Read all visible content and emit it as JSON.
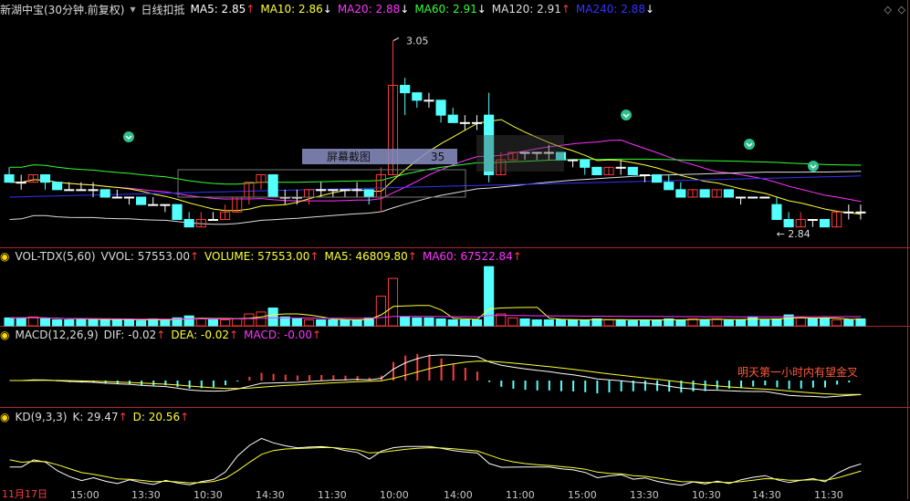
{
  "header": {
    "title": "新湖中宝(30分钟.前复权)",
    "indicator": "日线扣抵",
    "ma": [
      {
        "label": "MA5: 2.85",
        "arrow": "↑",
        "color": "#ffffff"
      },
      {
        "label": "MA10: 2.86",
        "arrow": "↓",
        "color": "#ffff33"
      },
      {
        "label": "MA20: 2.88",
        "arrow": "↓",
        "color": "#ff33ff"
      },
      {
        "label": "MA60: 2.91",
        "arrow": "↓",
        "color": "#33ff33"
      },
      {
        "label": "MA120: 2.91",
        "arrow": "↑",
        "color": "#dddddd"
      },
      {
        "label": "MA240: 2.88",
        "arrow": "↓",
        "color": "#3333ff"
      }
    ]
  },
  "volume_header": {
    "name": "VOL-TDX(5,60)",
    "vvol": "VVOL: 57553.00",
    "volume": "VOLUME: 57553.00",
    "ma5": "MA5: 46809.80",
    "ma60": "MA60: 67522.84"
  },
  "macd_header": {
    "name": "MACD(12,26,9)",
    "dif": "DIF: -0.02",
    "dea": "DEA: -0.02",
    "macd": "MACD: -0.00"
  },
  "kd_header": {
    "name": "KD(9,3,3)",
    "k": "K: 29.47",
    "d": "D: 20.56"
  },
  "annotations": {
    "high_label": "3.05",
    "low_label": "2.84",
    "overlay_box": "屏幕截图",
    "overlay_value": "35",
    "macd_note": "明天第一小时内有望金叉"
  },
  "x_axis": [
    "11月17日",
    "15:00",
    "13:30",
    "10:30",
    "14:30",
    "11:30",
    "10:00",
    "14:00",
    "11:00",
    "15:00",
    "13:30",
    "10:30",
    "14:30",
    "11:30"
  ],
  "colors": {
    "up": "#ff3b3b",
    "down": "#54ffff",
    "grid": "#b0272d"
  },
  "chart_data": {
    "type": "candlestick",
    "interval": "30min",
    "ohlc": [
      [
        2.87,
        2.88,
        2.86,
        2.86
      ],
      [
        2.86,
        2.87,
        2.85,
        2.86
      ],
      [
        2.86,
        2.87,
        2.86,
        2.87
      ],
      [
        2.87,
        2.87,
        2.85,
        2.86
      ],
      [
        2.86,
        2.86,
        2.85,
        2.85
      ],
      [
        2.85,
        2.86,
        2.85,
        2.85
      ],
      [
        2.85,
        2.86,
        2.85,
        2.85
      ],
      [
        2.85,
        2.86,
        2.84,
        2.85
      ],
      [
        2.85,
        2.85,
        2.84,
        2.84
      ],
      [
        2.84,
        2.85,
        2.84,
        2.84
      ],
      [
        2.84,
        2.84,
        2.83,
        2.84
      ],
      [
        2.84,
        2.84,
        2.83,
        2.83
      ],
      [
        2.83,
        2.84,
        2.83,
        2.83
      ],
      [
        2.83,
        2.83,
        2.82,
        2.83
      ],
      [
        2.83,
        2.83,
        2.81,
        2.81
      ],
      [
        2.81,
        2.82,
        2.8,
        2.8
      ],
      [
        2.8,
        2.82,
        2.8,
        2.81
      ],
      [
        2.81,
        2.82,
        2.81,
        2.81
      ],
      [
        2.81,
        2.83,
        2.81,
        2.82
      ],
      [
        2.82,
        2.84,
        2.82,
        2.84
      ],
      [
        2.84,
        2.86,
        2.83,
        2.86
      ],
      [
        2.86,
        2.87,
        2.85,
        2.87
      ],
      [
        2.87,
        2.87,
        2.84,
        2.84
      ],
      [
        2.84,
        2.85,
        2.83,
        2.84
      ],
      [
        2.84,
        2.85,
        2.83,
        2.84
      ],
      [
        2.84,
        2.85,
        2.83,
        2.85
      ],
      [
        2.85,
        2.86,
        2.84,
        2.85
      ],
      [
        2.85,
        2.85,
        2.84,
        2.85
      ],
      [
        2.85,
        2.85,
        2.84,
        2.85
      ],
      [
        2.85,
        2.86,
        2.84,
        2.85
      ],
      [
        2.85,
        2.85,
        2.83,
        2.84
      ],
      [
        2.84,
        2.88,
        2.82,
        2.87
      ],
      [
        2.87,
        3.05,
        2.87,
        2.99
      ],
      [
        2.99,
        3.0,
        2.95,
        2.98
      ],
      [
        2.98,
        2.98,
        2.96,
        2.97
      ],
      [
        2.97,
        2.98,
        2.96,
        2.97
      ],
      [
        2.97,
        2.97,
        2.94,
        2.95
      ],
      [
        2.95,
        2.96,
        2.94,
        2.94
      ],
      [
        2.94,
        2.95,
        2.93,
        2.94
      ],
      [
        2.94,
        2.95,
        2.93,
        2.94
      ],
      [
        2.95,
        2.98,
        2.86,
        2.87
      ],
      [
        2.87,
        2.9,
        2.87,
        2.89
      ],
      [
        2.89,
        2.9,
        2.89,
        2.9
      ],
      [
        2.9,
        2.9,
        2.89,
        2.9
      ],
      [
        2.9,
        2.9,
        2.89,
        2.9
      ],
      [
        2.9,
        2.91,
        2.89,
        2.9
      ],
      [
        2.9,
        2.9,
        2.89,
        2.89
      ],
      [
        2.89,
        2.89,
        2.88,
        2.89
      ],
      [
        2.89,
        2.89,
        2.87,
        2.88
      ],
      [
        2.88,
        2.88,
        2.87,
        2.87
      ],
      [
        2.87,
        2.88,
        2.87,
        2.88
      ],
      [
        2.88,
        2.89,
        2.87,
        2.88
      ],
      [
        2.88,
        2.88,
        2.87,
        2.87
      ],
      [
        2.87,
        2.87,
        2.86,
        2.87
      ],
      [
        2.87,
        2.87,
        2.86,
        2.86
      ],
      [
        2.86,
        2.87,
        2.85,
        2.85
      ],
      [
        2.85,
        2.86,
        2.84,
        2.84
      ],
      [
        2.84,
        2.85,
        2.84,
        2.85
      ],
      [
        2.85,
        2.85,
        2.84,
        2.84
      ],
      [
        2.84,
        2.85,
        2.84,
        2.85
      ],
      [
        2.85,
        2.85,
        2.84,
        2.84
      ],
      [
        2.84,
        2.84,
        2.83,
        2.84
      ],
      [
        2.84,
        2.84,
        2.84,
        2.84
      ],
      [
        2.84,
        2.84,
        2.84,
        2.84
      ],
      [
        2.83,
        2.84,
        2.81,
        2.81
      ],
      [
        2.81,
        2.82,
        2.8,
        2.8
      ],
      [
        2.8,
        2.82,
        2.8,
        2.81
      ],
      [
        2.81,
        2.81,
        2.8,
        2.81
      ],
      [
        2.81,
        2.81,
        2.8,
        2.8
      ],
      [
        2.8,
        2.82,
        2.8,
        2.82
      ],
      [
        2.82,
        2.83,
        2.81,
        2.82
      ],
      [
        2.82,
        2.83,
        2.81,
        2.82
      ]
    ],
    "volume_levels": [
      8,
      8,
      9,
      7,
      6,
      6,
      7,
      7,
      6,
      6,
      6,
      5,
      7,
      6,
      8,
      10,
      7,
      6,
      6,
      7,
      12,
      14,
      18,
      9,
      7,
      6,
      6,
      6,
      6,
      6,
      8,
      30,
      48,
      9,
      8,
      8,
      7,
      6,
      6,
      6,
      60,
      12,
      8,
      7,
      6,
      6,
      6,
      6,
      6,
      7,
      6,
      6,
      5,
      6,
      6,
      7,
      6,
      7,
      6,
      7,
      6,
      6,
      9,
      6,
      7,
      11,
      8,
      7,
      7,
      6,
      6,
      7
    ]
  }
}
